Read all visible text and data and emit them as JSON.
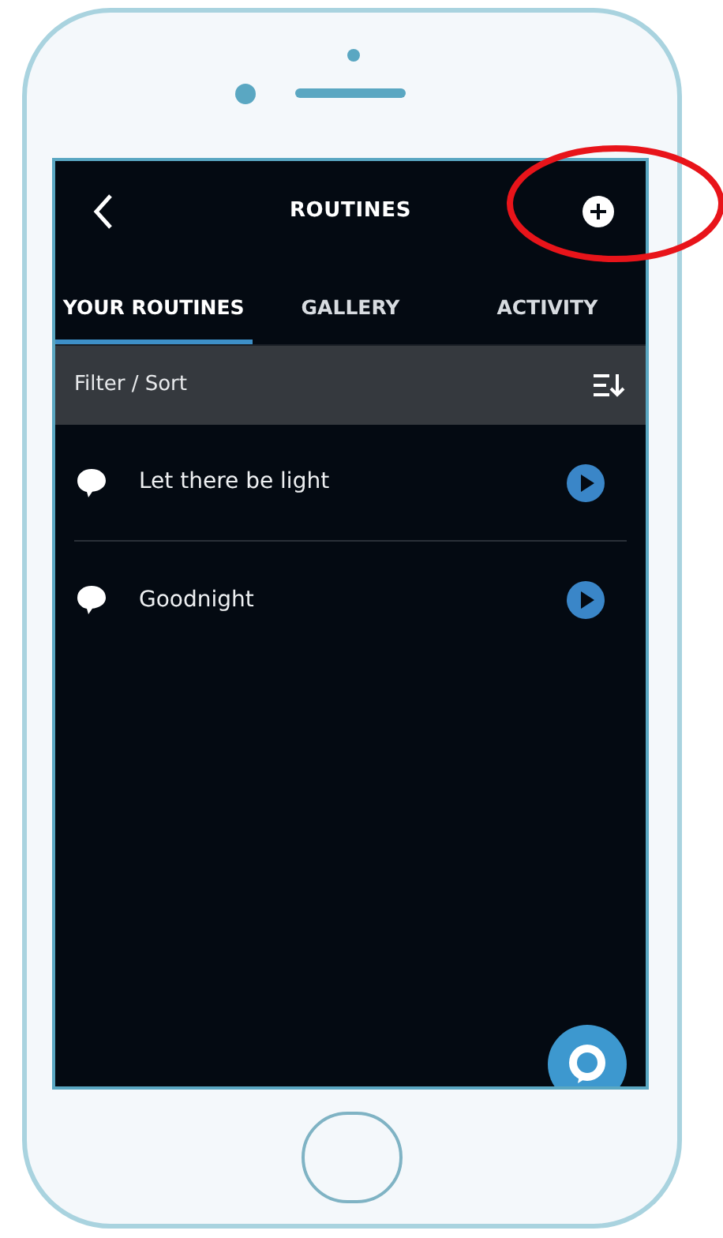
{
  "header": {
    "title": "ROUTINES"
  },
  "tabs": [
    {
      "label": "YOUR ROUTINES",
      "selected": true
    },
    {
      "label": "GALLERY",
      "selected": false
    },
    {
      "label": "ACTIVITY",
      "selected": false
    }
  ],
  "filter_bar": {
    "label": "Filter / Sort"
  },
  "routines": [
    {
      "name": "Let there be light"
    },
    {
      "name": "Goodnight"
    }
  ]
}
